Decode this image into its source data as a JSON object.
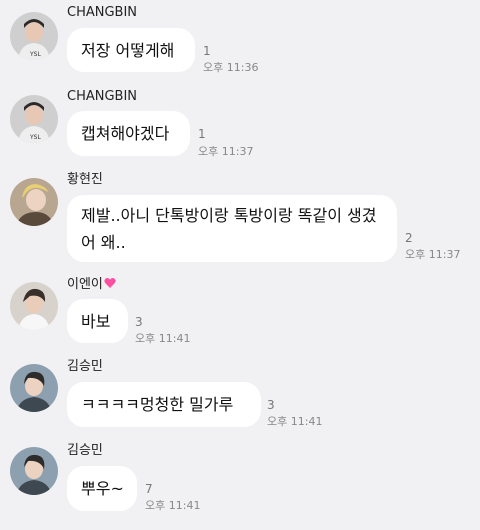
{
  "messages": [
    {
      "sender": "CHANGBIN",
      "text": "저장 어떻게해",
      "unread": "1",
      "time": "오후 11:36"
    },
    {
      "sender": "CHANGBIN",
      "text": "캡쳐해야겠다",
      "unread": "1",
      "time": "오후 11:37"
    },
    {
      "sender": "황현진",
      "text": "제발..아니 단톡방이랑 톡방이랑 똑같이 생겼어 왜..",
      "unread": "2",
      "time": "오후 11:37"
    },
    {
      "sender": "이엔이",
      "text": "바보",
      "unread": "3",
      "time": "오후 11:41"
    },
    {
      "sender": "김승민",
      "text": "ㅋㅋㅋㅋ멍청한 밀가루",
      "unread": "3",
      "time": "오후 11:41"
    },
    {
      "sender": "김승민",
      "text": "뿌우~",
      "unread": "7",
      "time": "오후 11:41"
    }
  ],
  "colors": {
    "background": "#f1f1f3",
    "bubble": "#ffffff",
    "heart": "#ff4fa0"
  },
  "icons": {
    "heart": "pink-heart-icon"
  }
}
